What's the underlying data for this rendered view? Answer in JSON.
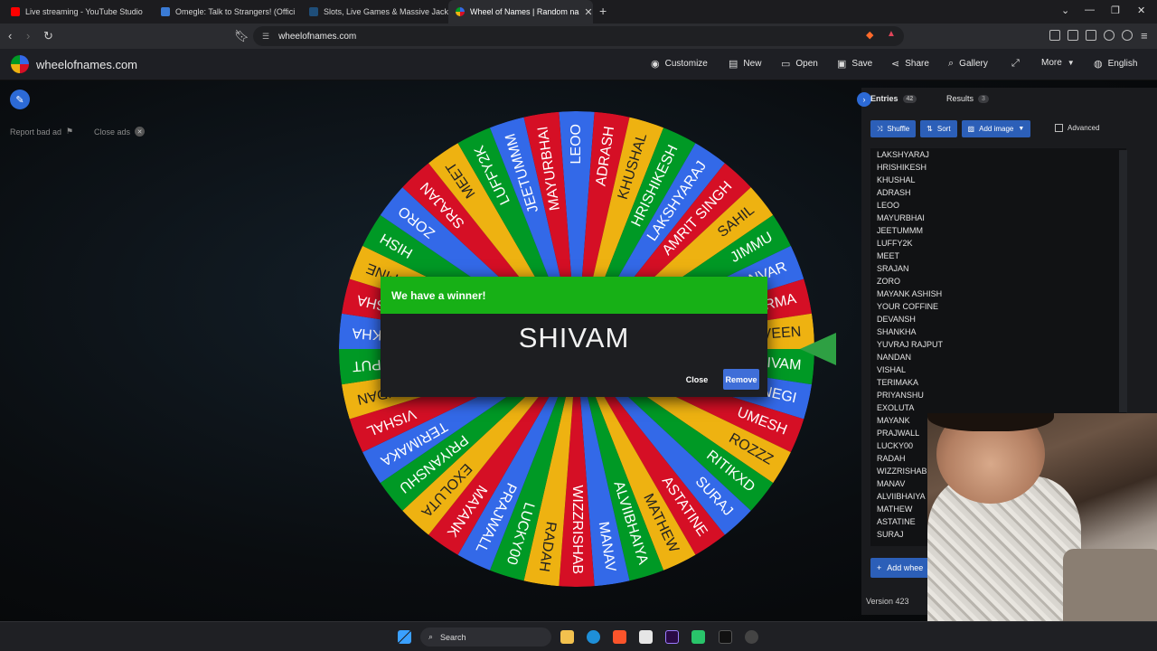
{
  "browser": {
    "tabs": [
      {
        "title": "Live streaming - YouTube Studio",
        "color": "#ff0000",
        "active": false
      },
      {
        "title": "Omegle: Talk to Strangers! (Offici",
        "color": "#3a7bd5",
        "active": false
      },
      {
        "title": "Slots, Live Games & Massive Jackpot",
        "color": "#1f4e79",
        "active": false
      },
      {
        "title": "Wheel of Names | Random na",
        "color": "#34a853",
        "active": true
      }
    ],
    "url": "wheelofnames.com"
  },
  "site": {
    "logo_text": "wheelofnames.com",
    "menu": [
      {
        "label": "Customize",
        "icon": "palette-icon"
      },
      {
        "label": "New",
        "icon": "new-file-icon"
      },
      {
        "label": "Open",
        "icon": "folder-icon"
      },
      {
        "label": "Save",
        "icon": "save-icon"
      },
      {
        "label": "Share",
        "icon": "share-icon"
      },
      {
        "label": "Gallery",
        "icon": "search-icon"
      },
      {
        "label": "",
        "icon": "fullscreen-icon"
      },
      {
        "label": "More",
        "icon": "chevron-down-icon"
      },
      {
        "label": "English",
        "icon": "globe-icon"
      }
    ],
    "report_ad": "Report bad ad",
    "close_ads": "Close ads"
  },
  "wheel": {
    "colors": [
      "#3369e8",
      "#d50f25",
      "#eeb211",
      "#009925"
    ],
    "segments": [
      "LEOO",
      "ADRASH",
      "KHUSHAL",
      "HRISHIKESH",
      "LAKSHYARAJ",
      "AMRIT SINGH",
      "SAHIL",
      "JIMMU",
      "DOLLANVAR",
      "RMA",
      "VEEN",
      "SHIVAM",
      "NEGI",
      "UMESH",
      "ROZZZ",
      "RITIKXD",
      "SURAJ",
      "ASTATINE",
      "MATHEW",
      "ALVIIBHAIYA",
      "MANAV",
      "WIZZRISHAB",
      "RADAH",
      "LUCKY00",
      "PRAJWALL",
      "MAYANK",
      "EXOLUTA",
      "PRIYANSHU",
      "TERIMAKA",
      "VISHAL",
      "NANDAN",
      "PUT",
      "KHA",
      "NSHA",
      "FINE",
      "HISH",
      "ZORO",
      "SRAJAN",
      "MEET",
      "LUFFY2K",
      "JEETUMMM",
      "MAYURBHAI"
    ]
  },
  "dialog": {
    "title": "We have a winner!",
    "winner": "SHIVAM",
    "close": "Close",
    "remove": "Remove"
  },
  "panel": {
    "entries_tab": "Entries",
    "entries_count": "42",
    "results_tab": "Results",
    "results_count": "3",
    "shuffle": "Shuffle",
    "sort": "Sort",
    "add_image": "Add image",
    "advanced": "Advanced",
    "entries": [
      "LAKSHYARAJ",
      "HRISHIKESH",
      "KHUSHAL",
      "ADRASH",
      "LEOO",
      "MAYURBHAI",
      "JEETUMMM",
      "LUFFY2K",
      "MEET",
      "SRAJAN",
      "ZORO",
      "MAYANK ASHISH",
      "YOUR COFFINE",
      "DEVANSH",
      "SHANKHA",
      "YUVRAJ RAJPUT",
      "NANDAN",
      "VISHAL",
      "TERIMAKA",
      "PRIYANSHU",
      "EXOLUTA",
      "MAYANK",
      "PRAJWALL",
      "LUCKY00",
      "RADAH",
      "WIZZRISHAB",
      "MANAV",
      "ALVIIBHAIYA",
      "MATHEW",
      "ASTATINE",
      "SURAJ"
    ],
    "add_wheel": "Add whee",
    "version": "Version 423"
  },
  "taskbar": {
    "search": "Search"
  }
}
